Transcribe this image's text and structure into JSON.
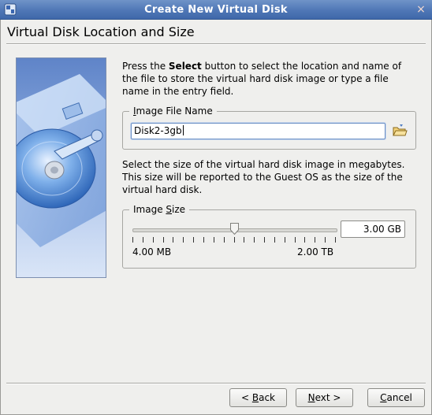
{
  "window": {
    "title": "Create New Virtual Disk",
    "close_glyph": "×"
  },
  "page": {
    "title": "Virtual Disk Location and Size"
  },
  "intro": {
    "before": "Press the ",
    "bold": "Select",
    "after": " button to select the location and name of the file to store the virtual hard disk image or type a file name in the entry field."
  },
  "image_file": {
    "legend_pre": "",
    "legend_mnemonic": "I",
    "legend_post": "mage File Name",
    "value": "Disk2-3gb",
    "browse_icon": "folder-open-icon"
  },
  "size_description": "Select the size of the virtual hard disk image in megabytes. This size will be reported to the Guest OS as the size of the virtual hard disk.",
  "image_size": {
    "legend_pre": "Image ",
    "legend_mnemonic": "S",
    "legend_post": "ize",
    "slider_position": 0.5,
    "min_label": "4.00 MB",
    "max_label": "2.00 TB",
    "value": "3.00 GB"
  },
  "buttons": {
    "back_pre": "< ",
    "back_mnemonic": "B",
    "back_post": "ack",
    "next_mnemonic": "N",
    "next_post": "ext >",
    "cancel_mnemonic": "C",
    "cancel_post": "ancel"
  },
  "colors": {
    "titlebar": "#4f77b6",
    "accent": "#6b8fc5"
  }
}
